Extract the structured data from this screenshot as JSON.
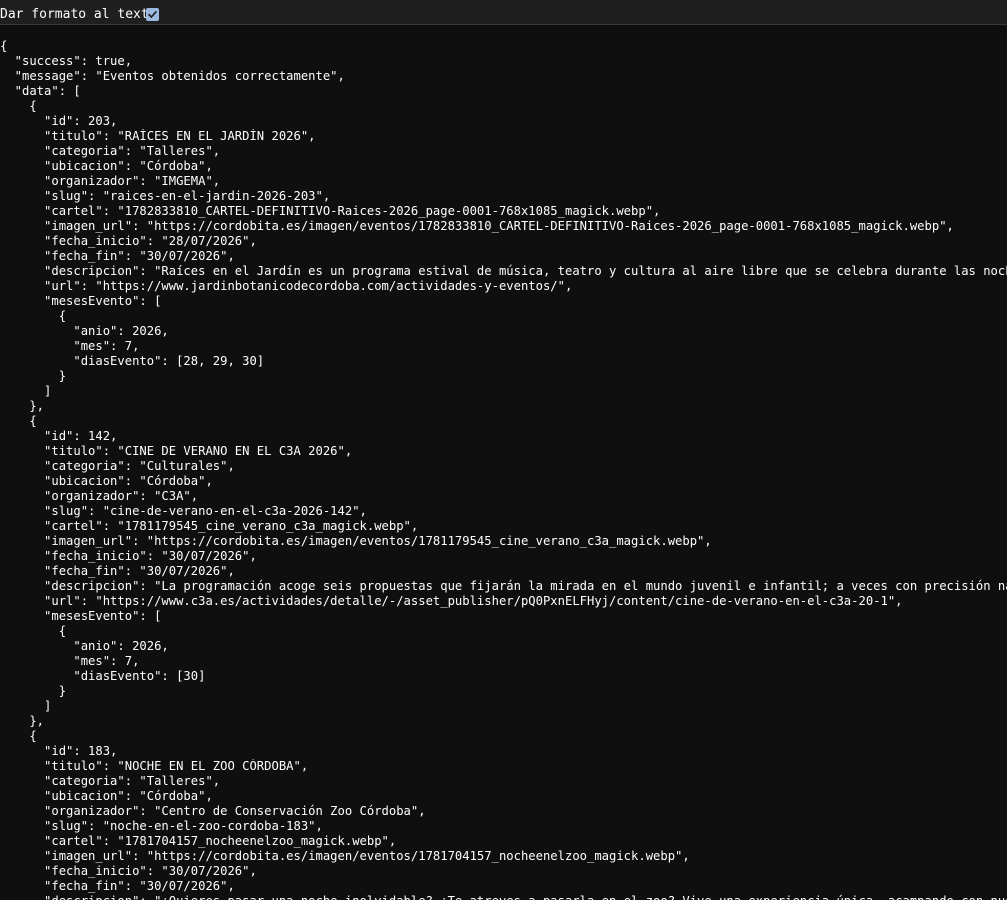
{
  "toolbar": {
    "format_label": "Dar formato al texto",
    "format_checked": true
  },
  "json_lines": [
    "{",
    "  \"success\": true,",
    "  \"message\": \"Eventos obtenidos correctamente\",",
    "  \"data\": [",
    "    {",
    "      \"id\": 203,",
    "      \"titulo\": \"RAÍCES EN EL JARDÍN 2026\",",
    "      \"categoria\": \"Talleres\",",
    "      \"ubicacion\": \"Córdoba\",",
    "      \"organizador\": \"IMGEMA\",",
    "      \"slug\": \"raices-en-el-jardin-2026-203\",",
    "      \"cartel\": \"1782833810_CARTEL-DEFINITIVO-Raices-2026_page-0001-768x1085_magick.webp\",",
    "      \"imagen_url\": \"https://cordobita.es/imagen/eventos/1782833810_CARTEL-DEFINITIVO-Raices-2026_page-0001-768x1085_magick.webp\",",
    "      \"fecha_inicio\": \"28/07/2026\",",
    "      \"fecha_fin\": \"30/07/2026\",",
    "      \"descripcion\": \"Raíces en el Jardín es un programa estival de música, teatro y cultura al aire libre que se celebra durante las noches",
    "      \"url\": \"https://www.jardinbotanicodecordoba.com/actividades-y-eventos/\",",
    "      \"mesesEvento\": [",
    "        {",
    "          \"anio\": 2026,",
    "          \"mes\": 7,",
    "          \"diasEvento\": [28, 29, 30]",
    "        }",
    "      ]",
    "    },",
    "    {",
    "      \"id\": 142,",
    "      \"titulo\": \"CINE DE VERANO EN EL C3A 2026\",",
    "      \"categoria\": \"Culturales\",",
    "      \"ubicacion\": \"Córdoba\",",
    "      \"organizador\": \"C3A\",",
    "      \"slug\": \"cine-de-verano-en-el-c3a-2026-142\",",
    "      \"cartel\": \"1781179545_cine_verano_c3a_magick.webp\",",
    "      \"imagen_url\": \"https://cordobita.es/imagen/eventos/1781179545_cine_verano_c3a_magick.webp\",",
    "      \"fecha_inicio\": \"30/07/2026\",",
    "      \"fecha_fin\": \"30/07/2026\",",
    "      \"descripcion\": \"La programación acoge seis propuestas que fijarán la mirada en el mundo juvenil e infantil; a veces con precisión natur",
    "      \"url\": \"https://www.c3a.es/actividades/detalle/-/asset_publisher/pQ0PxnELFHyj/content/cine-de-verano-en-el-c3a-20-1\",",
    "      \"mesesEvento\": [",
    "        {",
    "          \"anio\": 2026,",
    "          \"mes\": 7,",
    "          \"diasEvento\": [30]",
    "        }",
    "      ]",
    "    },",
    "    {",
    "      \"id\": 183,",
    "      \"titulo\": \"NOCHE EN EL ZOO CÓRDOBA\",",
    "      \"categoria\": \"Talleres\",",
    "      \"ubicacion\": \"Córdoba\",",
    "      \"organizador\": \"Centro de Conservación Zoo Córdoba\",",
    "      \"slug\": \"noche-en-el-zoo-cordoba-183\",",
    "      \"cartel\": \"1781704157_nocheenelzoo_magick.webp\",",
    "      \"imagen_url\": \"https://cordobita.es/imagen/eventos/1781704157_nocheenelzoo_magick.webp\",",
    "      \"fecha_inicio\": \"30/07/2026\",",
    "      \"fecha_fin\": \"30/07/2026\",",
    "      \"descripcion\": \"¿Quieres pasar una noche inolvidable? ¿Te atreves a pasarla en el zoo? Vive una experiencia única, acampando con nuestr"
  ]
}
